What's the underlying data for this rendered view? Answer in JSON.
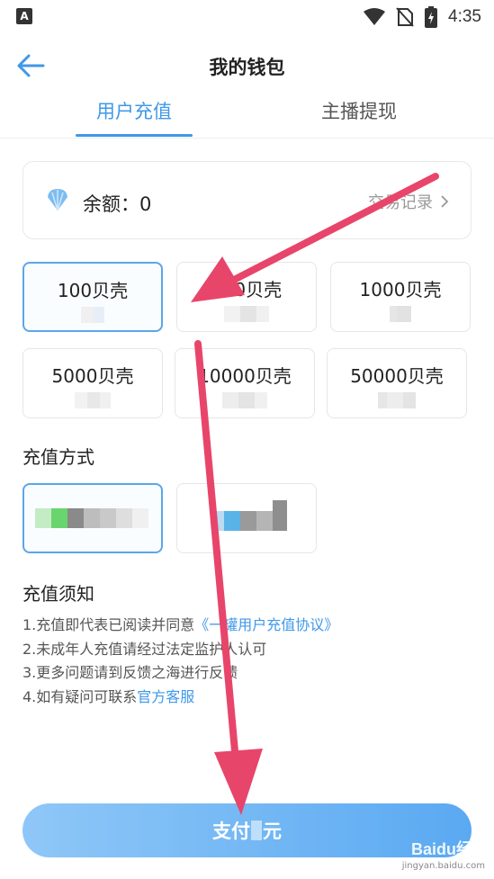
{
  "status_bar": {
    "time": "4:35",
    "left_icon": "A"
  },
  "header": {
    "title": "我的钱包",
    "back_icon": "arrow-left-icon"
  },
  "tabs": [
    {
      "label": "用户充值",
      "active": true
    },
    {
      "label": "主播提现",
      "active": false
    }
  ],
  "balance": {
    "label": "余额：0",
    "records_label": "交易记录"
  },
  "packages": [
    {
      "amount": "100贝壳"
    },
    {
      "amount": "500贝壳"
    },
    {
      "amount": "1000贝壳"
    },
    {
      "amount": "5000贝壳"
    },
    {
      "amount": "10000贝壳"
    },
    {
      "amount": "50000贝壳"
    }
  ],
  "payment": {
    "title": "充值方式"
  },
  "notice": {
    "title": "充值须知",
    "line1_text": "1.充值即代表已阅读并同意",
    "line1_link": "《一罐用户充值协议》",
    "line2": "2.未成年人充值请经过法定监护人认可",
    "line3": "3.更多问题请到反馈之海进行反馈",
    "line4_text": "4.如有疑问可联系",
    "line4_link": "官方客服"
  },
  "pay_button": {
    "prefix": "支付",
    "suffix": "元"
  },
  "watermark": {
    "brand": "Baidu经验",
    "url": "jingyan.baidu.com"
  },
  "colors": {
    "accent": "#3f98e8",
    "arrow": "#e8456b"
  }
}
